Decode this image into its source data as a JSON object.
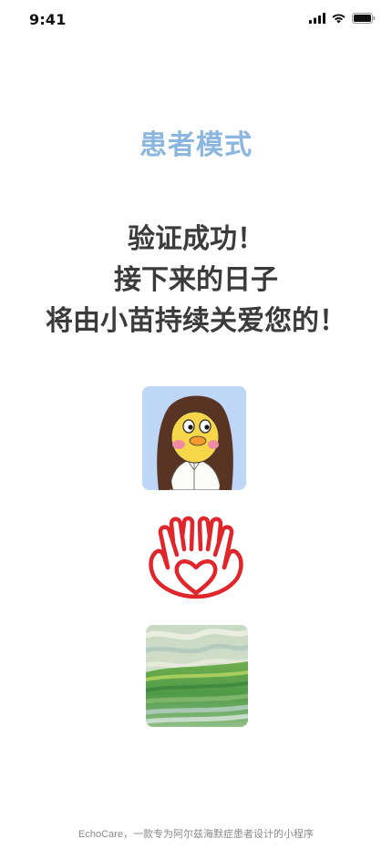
{
  "status_bar": {
    "time": "9:41"
  },
  "header": {
    "mode_title": "患者模式"
  },
  "message": {
    "line1": "验证成功！",
    "line2": "接下来的日子",
    "line3": "将由小苗持续关爱您的！"
  },
  "images": {
    "avatar": "cartoon-duck-avatar",
    "logo": "heart-hands-logo",
    "painting": "green-field-painting"
  },
  "footer": {
    "text": "EchoCare，一款专为阿尔兹海默症患者设计的小程序"
  },
  "colors": {
    "accent": "#8ab6e0",
    "logo_red": "#e0262b",
    "text_dark": "#3b3b3b",
    "footer_gray": "#8a8a8a"
  }
}
